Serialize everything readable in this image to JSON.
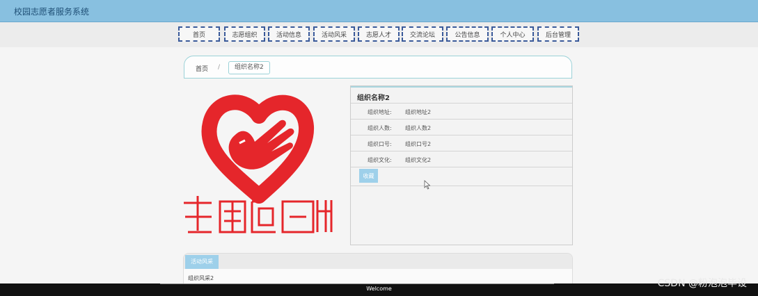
{
  "app": {
    "title": "校园志愿者服务系统"
  },
  "nav": [
    {
      "label": "首页"
    },
    {
      "label": "志愿组织"
    },
    {
      "label": "活动信息"
    },
    {
      "label": "活动风采"
    },
    {
      "label": "志愿人才"
    },
    {
      "label": "交流论坛"
    },
    {
      "label": "公告信息"
    },
    {
      "label": "个人中心"
    },
    {
      "label": "后台管理"
    }
  ],
  "breadcrumb": {
    "home": "首页",
    "separator": "/",
    "current": "组织名称2"
  },
  "org": {
    "name": "组织名称2",
    "fields": [
      {
        "label": "组织地址:",
        "value": "组织地址2"
      },
      {
        "label": "组织人数:",
        "value": "组织人数2"
      },
      {
        "label": "组织口号:",
        "value": "组织口号2"
      },
      {
        "label": "组织文化:",
        "value": "组织文化2"
      }
    ],
    "collect_label": "收藏"
  },
  "tabs": [
    {
      "label": "活动风采"
    }
  ],
  "tab_content": "组织风采2",
  "footer": {
    "text": "Welcome"
  },
  "watermark": "CSDN @粉泡泡毕设",
  "colors": {
    "header": "#88c0e0",
    "accent": "#9ed0ea",
    "logo_red": "#e5262b"
  }
}
